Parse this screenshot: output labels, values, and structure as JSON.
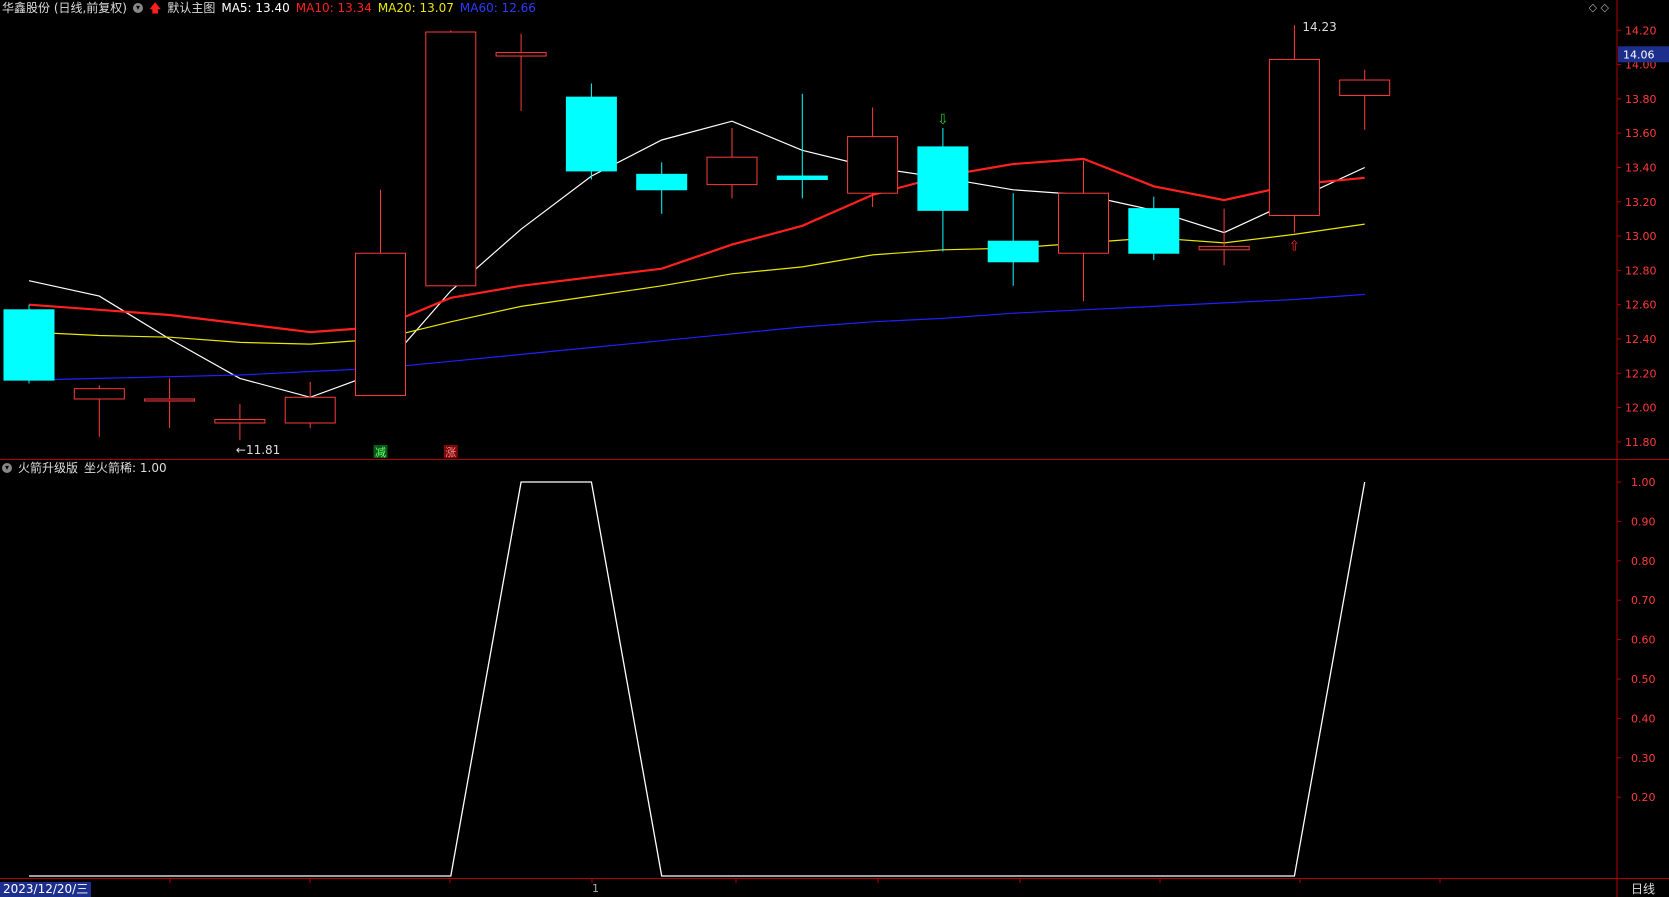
{
  "header": {
    "stock_title": "华鑫股份 (日线,前复权)",
    "main_chart_label": "默认主图",
    "ma5_label": "MA5: 13.40",
    "ma10_label": "MA10: 13.34",
    "ma20_label": "MA20: 13.07",
    "ma60_label": "MA60: 12.66",
    "colors": {
      "ma5": "#ffffff",
      "ma10": "#ff2020",
      "ma20": "#e8e800",
      "ma60": "#2020ff",
      "up": "#ff3b3b",
      "down": "#00ffff"
    }
  },
  "indicator": {
    "name": "火箭升级版",
    "value_label": "坐火箭稀: 1.00"
  },
  "footer": {
    "date": "2023/12/20/三",
    "period": "日线",
    "tick_one": "1"
  },
  "chart_data": [
    {
      "type": "candlestick",
      "title": "华鑫股份 (日线,前复权)",
      "ylim": [
        11.7,
        14.26
      ],
      "y_ticks": [
        "14.20",
        "14.00",
        "13.80",
        "13.60",
        "13.40",
        "13.20",
        "13.00",
        "12.80",
        "12.60",
        "12.40",
        "12.20",
        "12.00",
        "11.80"
      ],
      "current_price": "14.06",
      "candles": [
        {
          "o": 12.57,
          "h": 12.6,
          "l": 12.14,
          "c": 12.16
        },
        {
          "o": 12.05,
          "h": 12.13,
          "l": 11.83,
          "c": 12.11
        },
        {
          "o": 12.05,
          "h": 12.17,
          "l": 11.88,
          "c": 12.05
        },
        {
          "o": 11.91,
          "h": 12.02,
          "l": 11.81,
          "c": 11.93
        },
        {
          "o": 11.91,
          "h": 12.15,
          "l": 11.88,
          "c": 12.06
        },
        {
          "o": 12.07,
          "h": 13.27,
          "l": 12.07,
          "c": 12.9
        },
        {
          "o": 12.71,
          "h": 14.2,
          "l": 12.71,
          "c": 14.19
        },
        {
          "o": 14.05,
          "h": 14.18,
          "l": 13.73,
          "c": 14.07
        },
        {
          "o": 13.81,
          "h": 13.89,
          "l": 13.33,
          "c": 13.38
        },
        {
          "o": 13.36,
          "h": 13.43,
          "l": 13.13,
          "c": 13.27
        },
        {
          "o": 13.3,
          "h": 13.63,
          "l": 13.22,
          "c": 13.46
        },
        {
          "o": 13.35,
          "h": 13.83,
          "l": 13.22,
          "c": 13.33
        },
        {
          "o": 13.25,
          "h": 13.75,
          "l": 13.17,
          "c": 13.58
        },
        {
          "o": 13.52,
          "h": 13.63,
          "l": 12.91,
          "c": 13.15
        },
        {
          "o": 12.97,
          "h": 13.25,
          "l": 12.71,
          "c": 12.85
        },
        {
          "o": 12.9,
          "h": 13.44,
          "l": 12.62,
          "c": 13.25
        },
        {
          "o": 13.16,
          "h": 13.23,
          "l": 12.86,
          "c": 12.9
        },
        {
          "o": 12.92,
          "h": 13.16,
          "l": 12.83,
          "c": 12.94
        },
        {
          "o": 13.12,
          "h": 14.23,
          "l": 13.02,
          "c": 14.03
        },
        {
          "o": 13.82,
          "h": 13.97,
          "l": 13.62,
          "c": 13.91
        }
      ],
      "series": [
        {
          "name": "MA5",
          "values": [
            12.74,
            12.65,
            12.4,
            12.17,
            12.06,
            12.21,
            12.68,
            13.04,
            13.35,
            13.56,
            13.67,
            13.5,
            13.4,
            13.34,
            13.27,
            13.24,
            13.15,
            13.02,
            13.21,
            13.4
          ]
        },
        {
          "name": "MA10",
          "values": [
            12.6,
            12.57,
            12.54,
            12.49,
            12.44,
            12.47,
            12.64,
            12.71,
            12.76,
            12.81,
            12.95,
            13.06,
            13.24,
            13.35,
            13.42,
            13.45,
            13.29,
            13.21,
            13.3,
            13.34
          ]
        },
        {
          "name": "MA20",
          "values": [
            12.44,
            12.42,
            12.41,
            12.38,
            12.37,
            12.4,
            12.5,
            12.59,
            12.65,
            12.71,
            12.78,
            12.82,
            12.89,
            12.92,
            12.93,
            12.96,
            12.99,
            12.96,
            13.01,
            13.07
          ]
        },
        {
          "name": "MA60",
          "values": [
            12.16,
            12.17,
            12.18,
            12.19,
            12.21,
            12.23,
            12.27,
            12.31,
            12.35,
            12.39,
            12.43,
            12.47,
            12.5,
            12.52,
            12.55,
            12.57,
            12.59,
            12.61,
            12.63,
            12.66
          ]
        }
      ],
      "annotations": [
        {
          "text": "←11.81",
          "candle": 3,
          "price": 11.81
        },
        {
          "text": "14.23",
          "candle": 18,
          "price": 14.23
        },
        {
          "text": "减",
          "candle": 5,
          "kind": "badge-green"
        },
        {
          "text": "涨",
          "candle": 6,
          "kind": "badge-red"
        },
        {
          "text": "⇩",
          "candle": 13,
          "kind": "arrow-green"
        },
        {
          "text": "⇧",
          "candle": 18,
          "kind": "arrow-red"
        }
      ]
    },
    {
      "type": "line",
      "title": "火箭升级版",
      "ylim": [
        0,
        1.0
      ],
      "y_ticks": [
        "1.00",
        "0.90",
        "0.80",
        "0.70",
        "0.60",
        "0.50",
        "0.40",
        "0.30",
        "0.20"
      ],
      "series": [
        {
          "name": "坐火箭稀",
          "values": [
            0,
            0,
            0,
            0,
            0,
            0,
            0,
            1,
            1,
            0,
            0,
            0,
            0,
            0,
            0,
            0,
            0,
            0,
            0,
            1
          ]
        }
      ]
    }
  ]
}
